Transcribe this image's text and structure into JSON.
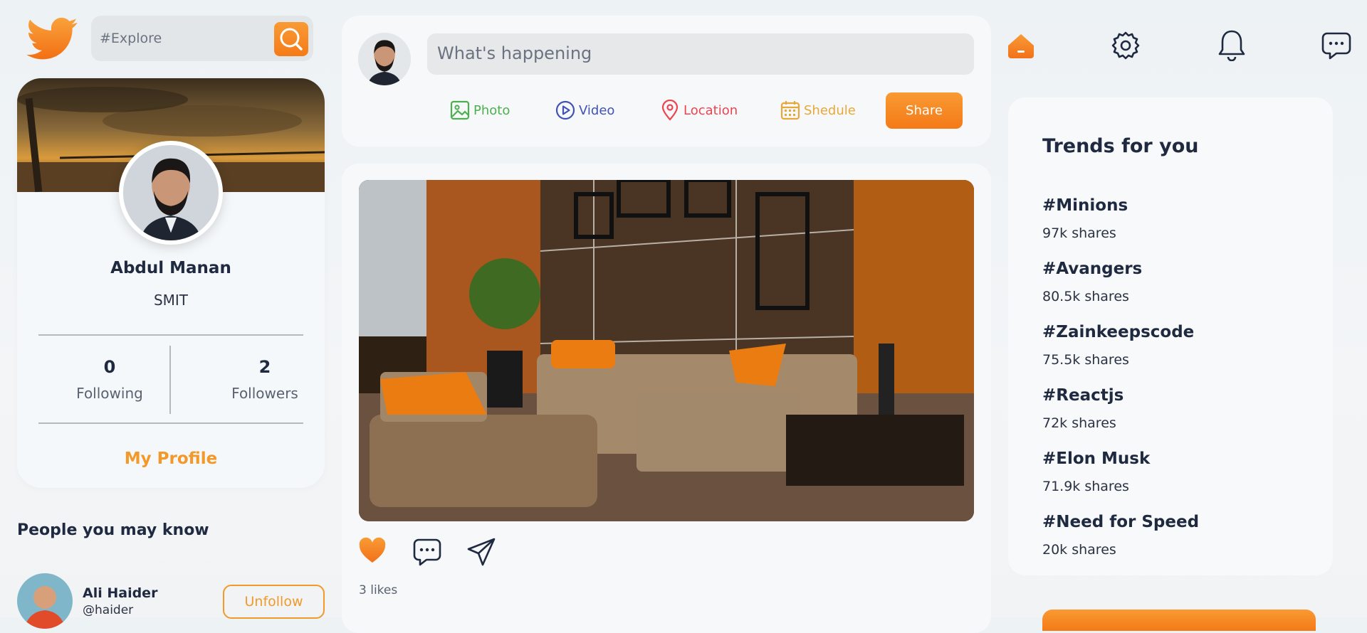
{
  "search": {
    "placeholder": "#Explore"
  },
  "profile": {
    "name": "Abdul Manan",
    "organization": "SMIT",
    "following_count": "0",
    "following_label": "Following",
    "followers_count": "2",
    "followers_label": "Followers",
    "my_profile_label": "My Profile"
  },
  "people_you_may_know": {
    "title": "People you may know",
    "items": [
      {
        "name": "Ali Haider",
        "handle": "@haider",
        "action_label": "Unfollow"
      }
    ]
  },
  "composer": {
    "placeholder": "What's happening",
    "options": [
      {
        "label": "Photo",
        "icon": "photo-icon",
        "color": "#4caf50"
      },
      {
        "label": "Video",
        "icon": "video-icon",
        "color": "#4052b5"
      },
      {
        "label": "Location",
        "icon": "location-icon",
        "color": "#ef4350"
      },
      {
        "label": "Shedule",
        "icon": "calendar-icon",
        "color": "#e8a838"
      }
    ],
    "share_label": "Share"
  },
  "post": {
    "likes_text": "3 likes",
    "actions": [
      "heart-icon",
      "comment-icon",
      "send-icon"
    ]
  },
  "topbar": {
    "icons": [
      "home-icon",
      "gear-icon",
      "bell-icon",
      "chat-icon"
    ]
  },
  "trends": {
    "title": "Trends for you",
    "items": [
      {
        "tag": "#Minions",
        "shares": "97k shares"
      },
      {
        "tag": "#Avangers",
        "shares": "80.5k shares"
      },
      {
        "tag": "#Zainkeepscode",
        "shares": "75.5k shares"
      },
      {
        "tag": "#Reactjs",
        "shares": "72k shares"
      },
      {
        "tag": "#Elon Musk",
        "shares": "71.9k shares"
      },
      {
        "tag": "#Need for Speed",
        "shares": "20k shares"
      }
    ]
  },
  "colors": {
    "accent": "#f47b18",
    "accent_light": "#f99b35",
    "text_dark": "#1f2a40"
  }
}
